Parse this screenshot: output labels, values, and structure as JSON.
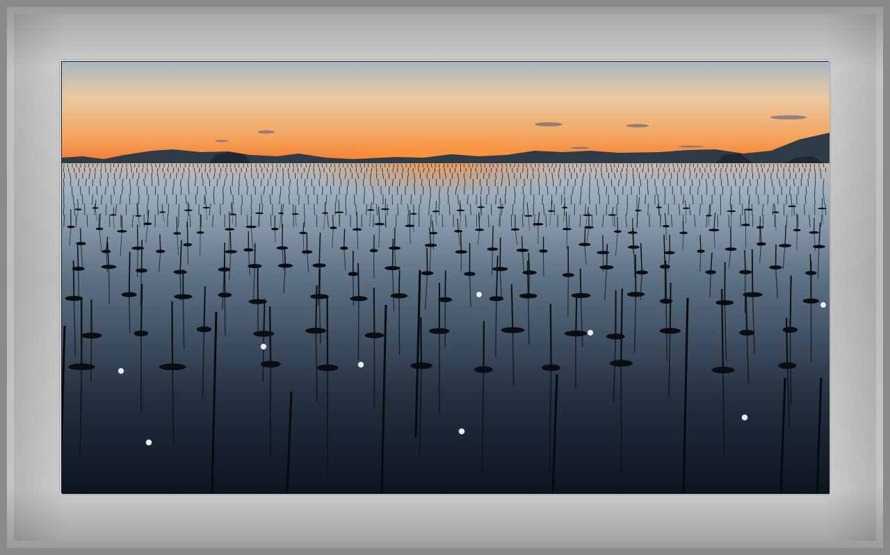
{
  "image": {
    "subject": "sunset-over-seaweed-farm-poles",
    "frame_color": "#bfbfbf",
    "sky_top_color": "#aab8c4",
    "sky_mid_color": "#f2c48e",
    "sky_horizon_color": "#f08a3a",
    "sun_color": "#ffb24a",
    "mountain_color": "#34404e",
    "water_top_color": "#9fb0c0",
    "water_bottom_color": "#0e1722",
    "pole_color": "#0c0f14"
  }
}
